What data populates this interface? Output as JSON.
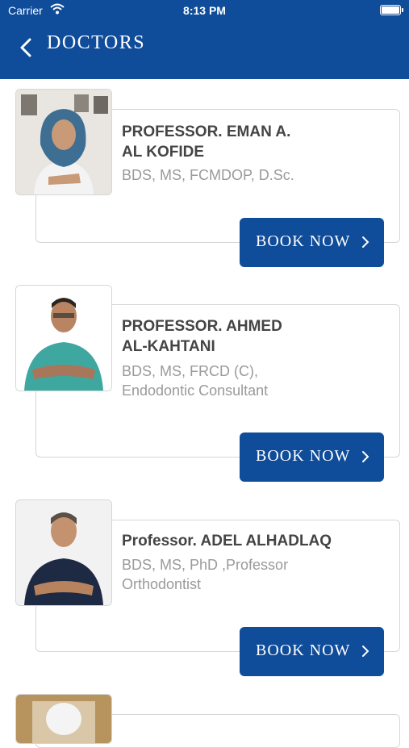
{
  "status_bar": {
    "carrier": "Carrier",
    "time": "8:13 PM"
  },
  "header": {
    "title": "DOCTORS",
    "back_icon": "chevron-left-icon"
  },
  "colors": {
    "primary": "#0f4c99",
    "card_border": "#d6d6d6",
    "name_text": "#444444",
    "quals_text": "#9a9a9a"
  },
  "doctors": [
    {
      "name_line1": "PROFESSOR. EMAN A.",
      "name_line2": "AL KOFIDE",
      "quals_line1": "BDS, MS, FCMDOP, D.Sc.",
      "quals_line2": "",
      "book_label": "BOOK NOW"
    },
    {
      "name_line1": "PROFESSOR. AHMED",
      "name_line2": "AL-KAHTANI",
      "quals_line1": "BDS, MS, FRCD (C),",
      "quals_line2": "Endodontic Consultant",
      "book_label": "BOOK NOW"
    },
    {
      "name_line1": "Professor. ADEL ALHADLAQ",
      "name_line2": "",
      "quals_line1": "BDS, MS, PhD ,Professor",
      "quals_line2": "Orthodontist",
      "book_label": "BOOK NOW"
    }
  ]
}
